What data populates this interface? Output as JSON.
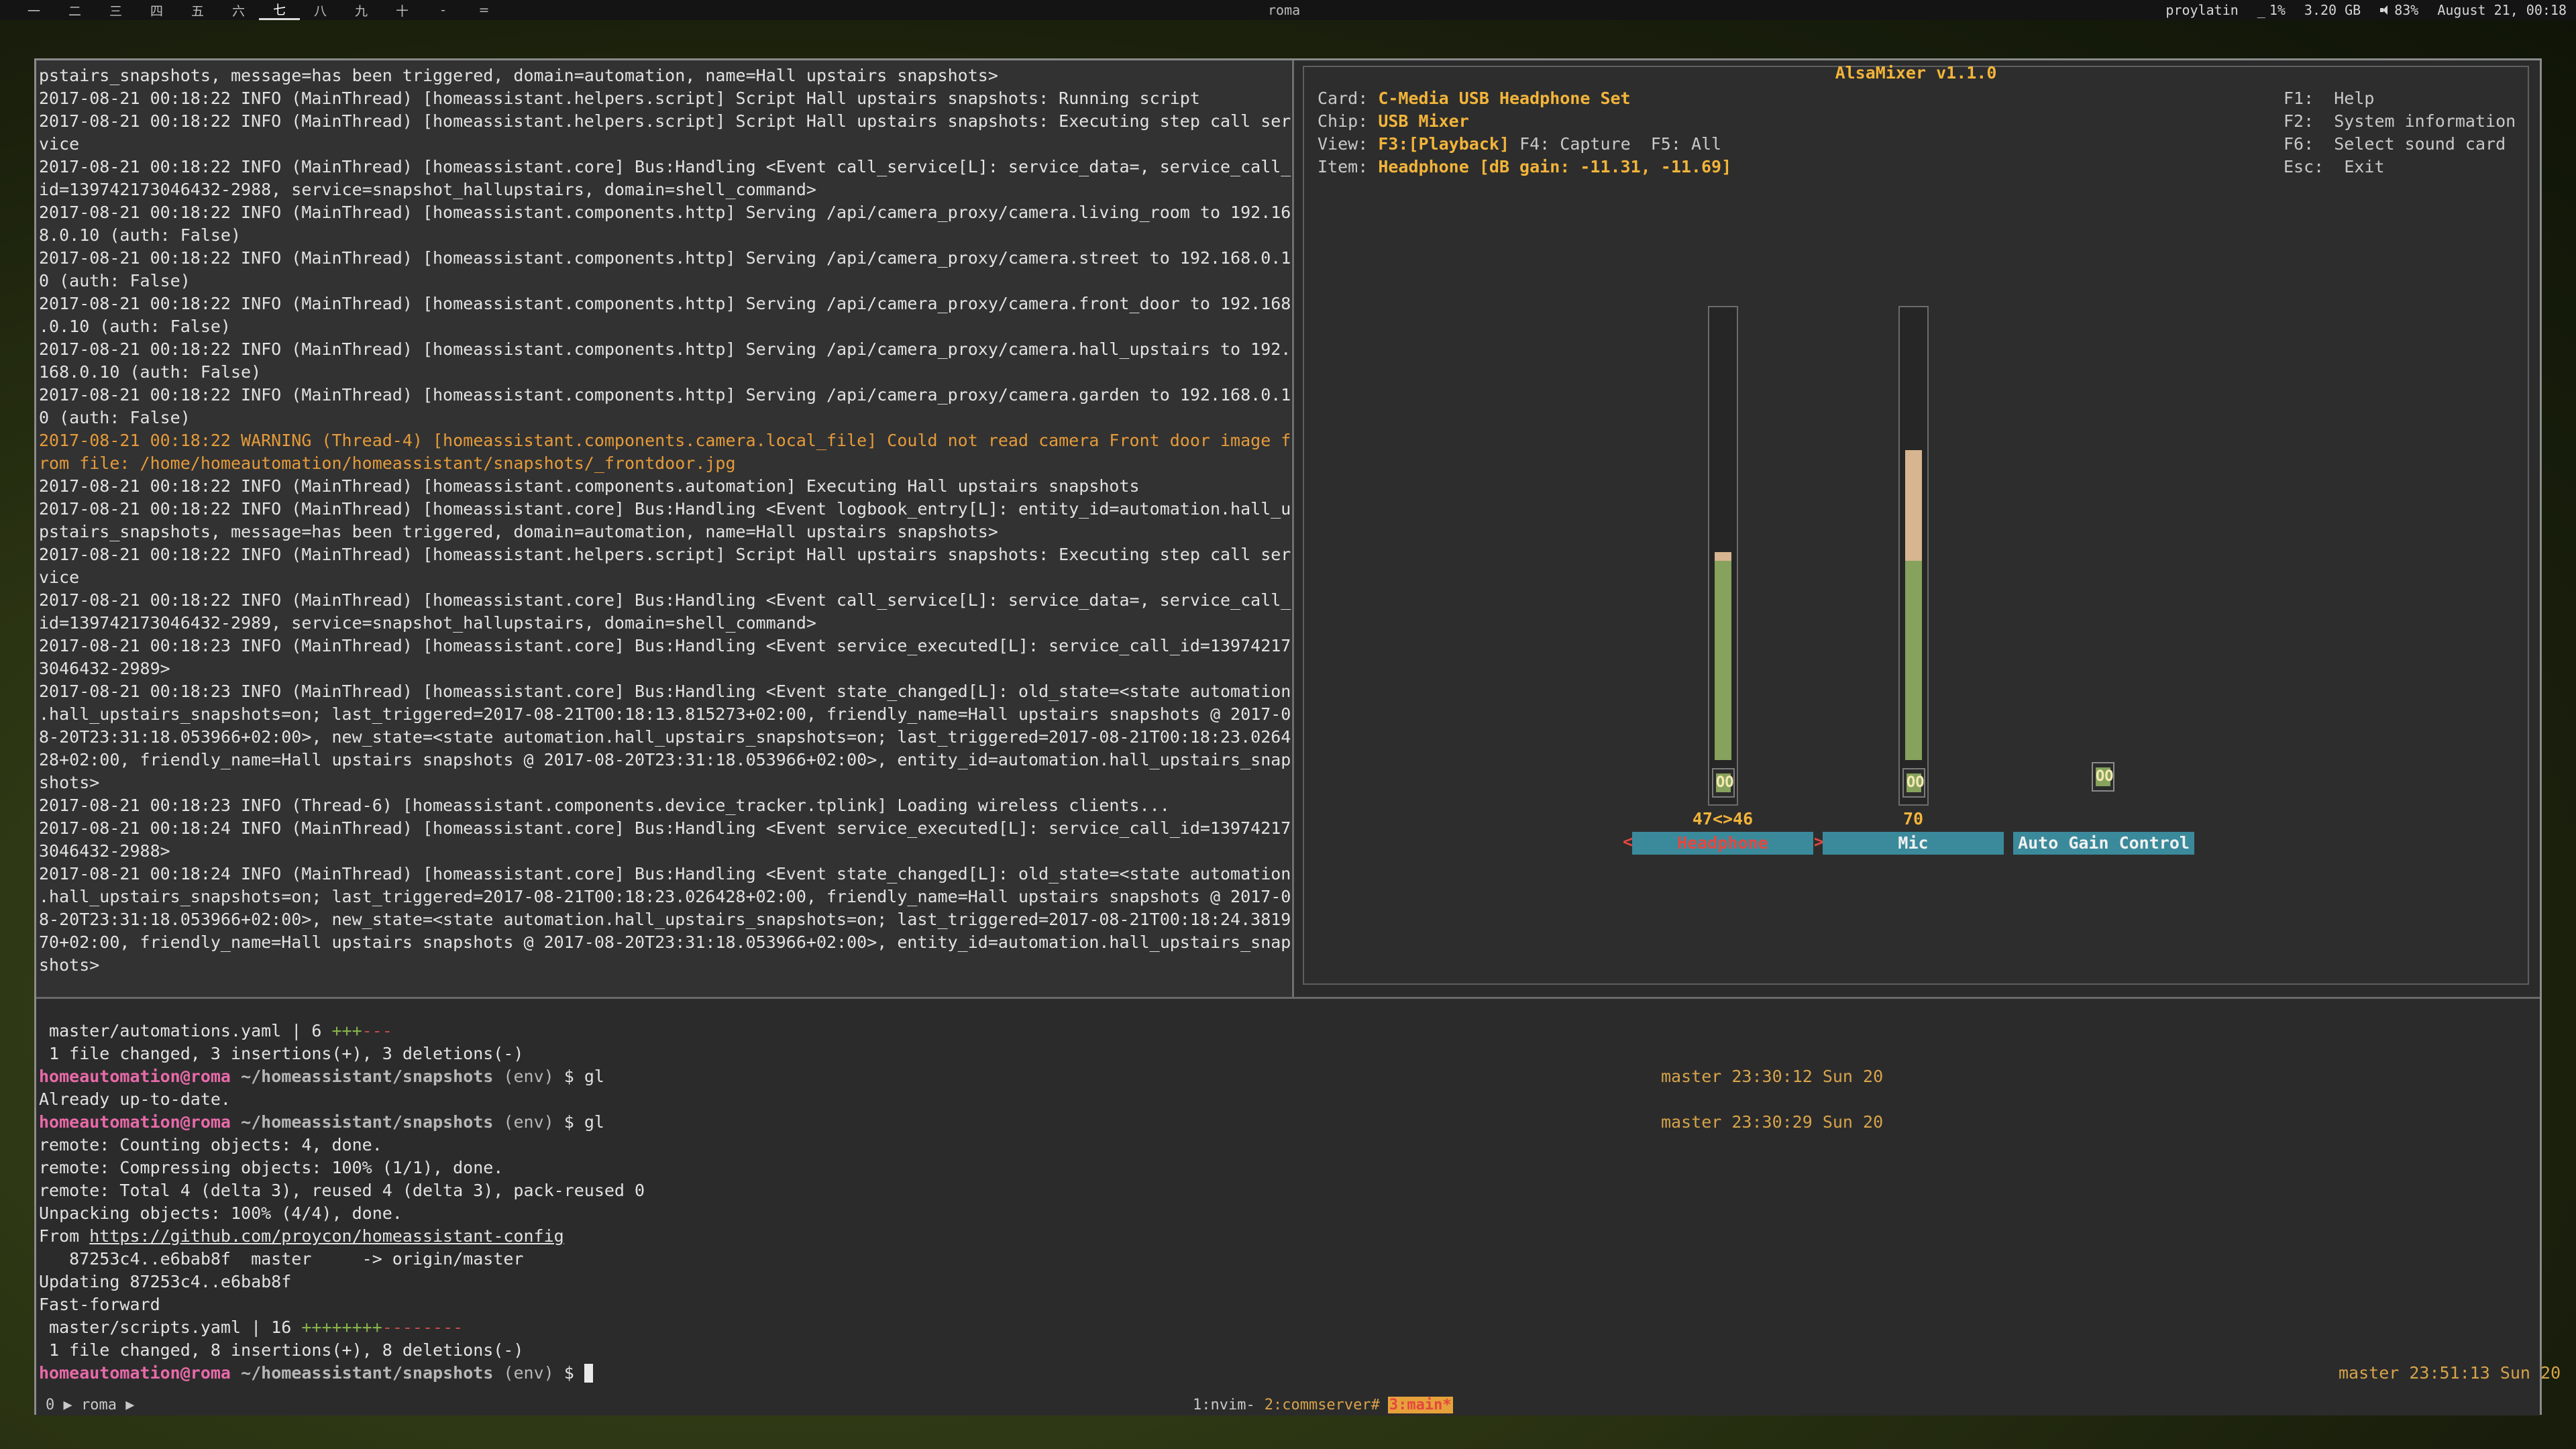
{
  "topbar": {
    "workspaces": [
      {
        "label": "一",
        "active": false
      },
      {
        "label": "二",
        "active": false
      },
      {
        "label": "三",
        "active": false
      },
      {
        "label": "四",
        "active": false
      },
      {
        "label": "五",
        "active": false
      },
      {
        "label": "六",
        "active": false
      },
      {
        "label": "七",
        "active": true
      },
      {
        "label": "八",
        "active": false
      },
      {
        "label": "九",
        "active": false
      },
      {
        "label": "十",
        "active": false
      },
      {
        "label": "-",
        "active": false
      },
      {
        "label": "=",
        "active": false
      }
    ],
    "hostname": "roma",
    "user": "proylatin",
    "cpu": "1%",
    "memory": "3.20 GB",
    "volume": "83%",
    "datetime": "August 21, 00:18"
  },
  "log": {
    "lines": [
      {
        "text": "pstairs_snapshots, message=has been triggered, domain=automation, name=Hall upstairs snapshots>",
        "level": "info"
      },
      {
        "text": "2017-08-21 00:18:22 INFO (MainThread) [homeassistant.helpers.script] Script Hall upstairs snapshots: Running script",
        "level": "info"
      },
      {
        "text": "2017-08-21 00:18:22 INFO (MainThread) [homeassistant.helpers.script] Script Hall upstairs snapshots: Executing step call ser",
        "level": "info"
      },
      {
        "text": "vice",
        "level": "info"
      },
      {
        "text": "2017-08-21 00:18:22 INFO (MainThread) [homeassistant.core] Bus:Handling <Event call_service[L]: service_data=, service_call_",
        "level": "info"
      },
      {
        "text": "id=139742173046432-2988, service=snapshot_hallupstairs, domain=shell_command>",
        "level": "info"
      },
      {
        "text": "2017-08-21 00:18:22 INFO (MainThread) [homeassistant.components.http] Serving /api/camera_proxy/camera.living_room to 192.16",
        "level": "info"
      },
      {
        "text": "8.0.10 (auth: False)",
        "level": "info"
      },
      {
        "text": "2017-08-21 00:18:22 INFO (MainThread) [homeassistant.components.http] Serving /api/camera_proxy/camera.street to 192.168.0.1",
        "level": "info"
      },
      {
        "text": "0 (auth: False)",
        "level": "info"
      },
      {
        "text": "2017-08-21 00:18:22 INFO (MainThread) [homeassistant.components.http] Serving /api/camera_proxy/camera.front_door to 192.168",
        "level": "info"
      },
      {
        "text": ".0.10 (auth: False)",
        "level": "info"
      },
      {
        "text": "2017-08-21 00:18:22 INFO (MainThread) [homeassistant.components.http] Serving /api/camera_proxy/camera.hall_upstairs to 192.",
        "level": "info"
      },
      {
        "text": "168.0.10 (auth: False)",
        "level": "info"
      },
      {
        "text": "2017-08-21 00:18:22 INFO (MainThread) [homeassistant.components.http] Serving /api/camera_proxy/camera.garden to 192.168.0.1",
        "level": "info"
      },
      {
        "text": "0 (auth: False)",
        "level": "info"
      },
      {
        "text": "2017-08-21 00:18:22 WARNING (Thread-4) [homeassistant.components.camera.local_file] Could not read camera Front door image f",
        "level": "warn"
      },
      {
        "text": "rom file: /home/homeautomation/homeassistant/snapshots/_frontdoor.jpg",
        "level": "warn"
      },
      {
        "text": "2017-08-21 00:18:22 INFO (MainThread) [homeassistant.components.automation] Executing Hall upstairs snapshots",
        "level": "info"
      },
      {
        "text": "2017-08-21 00:18:22 INFO (MainThread) [homeassistant.core] Bus:Handling <Event logbook_entry[L]: entity_id=automation.hall_u",
        "level": "info"
      },
      {
        "text": "pstairs_snapshots, message=has been triggered, domain=automation, name=Hall upstairs snapshots>",
        "level": "info"
      },
      {
        "text": "2017-08-21 00:18:22 INFO (MainThread) [homeassistant.helpers.script] Script Hall upstairs snapshots: Executing step call ser",
        "level": "info"
      },
      {
        "text": "vice",
        "level": "info"
      },
      {
        "text": "2017-08-21 00:18:22 INFO (MainThread) [homeassistant.core] Bus:Handling <Event call_service[L]: service_data=, service_call_",
        "level": "info"
      },
      {
        "text": "id=139742173046432-2989, service=snapshot_hallupstairs, domain=shell_command>",
        "level": "info"
      },
      {
        "text": "2017-08-21 00:18:23 INFO (MainThread) [homeassistant.core] Bus:Handling <Event service_executed[L]: service_call_id=13974217",
        "level": "info"
      },
      {
        "text": "3046432-2989>",
        "level": "info"
      },
      {
        "text": "2017-08-21 00:18:23 INFO (MainThread) [homeassistant.core] Bus:Handling <Event state_changed[L]: old_state=<state automation",
        "level": "info"
      },
      {
        "text": ".hall_upstairs_snapshots=on; last_triggered=2017-08-21T00:18:13.815273+02:00, friendly_name=Hall upstairs snapshots @ 2017-0",
        "level": "info"
      },
      {
        "text": "8-20T23:31:18.053966+02:00>, new_state=<state automation.hall_upstairs_snapshots=on; last_triggered=2017-08-21T00:18:23.0264",
        "level": "info"
      },
      {
        "text": "28+02:00, friendly_name=Hall upstairs snapshots @ 2017-08-20T23:31:18.053966+02:00>, entity_id=automation.hall_upstairs_snap",
        "level": "info"
      },
      {
        "text": "shots>",
        "level": "info"
      },
      {
        "text": "2017-08-21 00:18:23 INFO (Thread-6) [homeassistant.components.device_tracker.tplink] Loading wireless clients...",
        "level": "info"
      },
      {
        "text": "2017-08-21 00:18:24 INFO (MainThread) [homeassistant.core] Bus:Handling <Event service_executed[L]: service_call_id=13974217",
        "level": "info"
      },
      {
        "text": "3046432-2988>",
        "level": "info"
      },
      {
        "text": "2017-08-21 00:18:24 INFO (MainThread) [homeassistant.core] Bus:Handling <Event state_changed[L]: old_state=<state automation",
        "level": "info"
      },
      {
        "text": ".hall_upstairs_snapshots=on; last_triggered=2017-08-21T00:18:23.026428+02:00, friendly_name=Hall upstairs snapshots @ 2017-0",
        "level": "info"
      },
      {
        "text": "8-20T23:31:18.053966+02:00>, new_state=<state automation.hall_upstairs_snapshots=on; last_triggered=2017-08-21T00:18:24.3819",
        "level": "info"
      },
      {
        "text": "70+02:00, friendly_name=Hall upstairs snapshots @ 2017-08-20T23:31:18.053966+02:00>, entity_id=automation.hall_upstairs_snap",
        "level": "info"
      },
      {
        "text": "shots>",
        "level": "info"
      }
    ]
  },
  "alsamixer": {
    "title": "AlsaMixer v1.1.0",
    "card_label": "Card:",
    "card_value": "C-Media USB Headphone Set",
    "chip_label": "Chip:",
    "chip_value": "USB Mixer",
    "view_label": "View:",
    "view_playback": "F3:[Playback]",
    "view_capture": "F4: Capture",
    "view_all": "F5: All",
    "item_label": "Item:",
    "item_value": "Headphone [dB gain: -11.31, -11.69]",
    "help": [
      {
        "key": "F1:",
        "desc": "Help"
      },
      {
        "key": "F2:",
        "desc": "System information"
      },
      {
        "key": "F6:",
        "desc": "Select sound card"
      },
      {
        "key": "Esc:",
        "desc": "Exit"
      }
    ],
    "channels": [
      {
        "name": "Headphone",
        "value_label": "47<>46",
        "level": 0.47,
        "mute_label": "OO",
        "selected": true
      },
      {
        "name": "Mic",
        "value_label": "70",
        "level": 0.7,
        "mute_label": "OO",
        "selected": false
      },
      {
        "name": "Auto Gain Control",
        "value_label": "",
        "mute_label": "OO",
        "selected": false
      }
    ],
    "selected_left_marker": "<",
    "selected_right_marker": ">"
  },
  "shell": {
    "user": "homeautomation",
    "host": "roma",
    "path": "~/homeassistant/snapshots",
    "env": "(env)",
    "prompt_symbol": "$",
    "lines": {
      "stat1_file": " master/automations.yaml | 6 ",
      "stat1_plus": "+++",
      "stat1_minus": "---",
      "stat1_summary": " 1 file changed, 3 insertions(+), 3 deletions(-)",
      "cmd1": "gl",
      "cmd1_rprompt": "master 23:30:12 Sun 20",
      "out_uptodate": "Already up-to-date.",
      "cmd2": "gl",
      "cmd2_rprompt": "master 23:30:29 Sun 20",
      "remote1": "remote: Counting objects: 4, done.",
      "remote2": "remote: Compressing objects: 100% (1/1), done.",
      "remote3": "remote: Total 4 (delta 3), reused 4 (delta 3), pack-reused 0",
      "unpacking": "Unpacking objects: 100% (4/4), done.",
      "from_label": "From ",
      "from_url": "https://github.com/proycon/homeassistant-config",
      "branch_line": "   87253c4..e6bab8f  master     -> origin/master",
      "updating": "Updating 87253c4..e6bab8f",
      "fast_forward": "Fast-forward",
      "stat2_file": " master/scripts.yaml | 16 ",
      "stat2_plus": "++++++++",
      "stat2_minus": "--------",
      "stat2_summary": " 1 file changed, 8 insertions(+), 8 deletions(-)",
      "cmd3_rprompt": "master 23:51:13 Sun 20"
    }
  },
  "tmux": {
    "session_left": "0 ▶ roma ▶",
    "windows": [
      {
        "label": "1:nvim-",
        "state": "normal"
      },
      {
        "label": "2:commserver#",
        "state": "alt"
      },
      {
        "label": "3:main*",
        "state": "active"
      }
    ]
  }
}
